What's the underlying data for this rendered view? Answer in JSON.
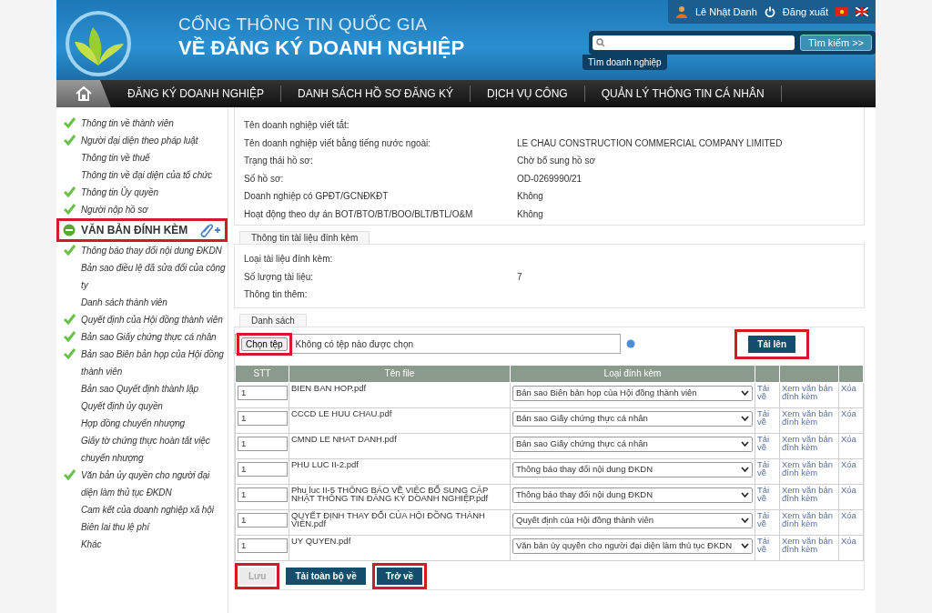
{
  "header": {
    "title_line1": "CỔNG THÔNG TIN QUỐC GIA",
    "title_line2": "VỀ ĐĂNG KÝ DOANH NGHIỆP",
    "user_name": "Lê Nhật Danh",
    "logout": "Đăng xuất",
    "search_button": "Tìm kiếm >>",
    "search_hint": "Tìm doanh nghiệp"
  },
  "nav": {
    "home_selected": true,
    "items": [
      "ĐĂNG KÝ DOANH NGHIỆP",
      "DANH SÁCH HỒ SƠ ĐĂNG KÝ",
      "DỊCH VỤ CÔNG",
      "QUẢN LÝ THÔNG TIN CÁ NHÂN"
    ]
  },
  "sidebar": {
    "items": [
      {
        "kind": "item",
        "label": "Thông tin về thành viên",
        "checked": true
      },
      {
        "kind": "item",
        "label": "Người đại diện theo pháp luật",
        "checked": true
      },
      {
        "kind": "item",
        "label": "Thông tin về thuế",
        "checked": false
      },
      {
        "kind": "item",
        "label": "Thông tin về đại diện của tổ chức",
        "checked": false
      },
      {
        "kind": "item",
        "label": "Thông tin Ủy quyền",
        "checked": true
      },
      {
        "kind": "item",
        "label": "Người nộp hồ sơ",
        "checked": true
      },
      {
        "kind": "section",
        "label": "VĂN BẢN ĐÍNH KÈM",
        "highlighted": true
      },
      {
        "kind": "item",
        "label": "Thông báo thay đổi nội dung ĐKDN",
        "checked": true
      },
      {
        "kind": "item",
        "label": "Bản sao điều lệ đã sửa đổi của công ty",
        "checked": false
      },
      {
        "kind": "item",
        "label": "Danh sách thành viên",
        "checked": false
      },
      {
        "kind": "item",
        "label": "Quyết định của Hội đồng thành viên",
        "checked": true
      },
      {
        "kind": "item",
        "label": "Bản sao Giấy chứng thực cá nhân",
        "checked": true
      },
      {
        "kind": "item",
        "label": "Bản sao Biên bản họp của Hội đồng thành viên",
        "checked": true
      },
      {
        "kind": "item",
        "label": "Bản sao Quyết định thành lập",
        "checked": false
      },
      {
        "kind": "item",
        "label": "Quyết định ủy quyền",
        "checked": false
      },
      {
        "kind": "item",
        "label": "Hợp đồng chuyển nhượng",
        "checked": false
      },
      {
        "kind": "item",
        "label": "Giấy tờ chứng thực hoàn tất việc chuyển nhượng",
        "checked": false
      },
      {
        "kind": "item",
        "label": "Văn bản ủy quyền cho người đại diện làm thủ tục ĐKDN",
        "checked": true
      },
      {
        "kind": "item",
        "label": "Cam kết của doanh nghiệp xã hội",
        "checked": false
      },
      {
        "kind": "item",
        "label": "Biên lai thu lệ phí",
        "checked": false
      },
      {
        "kind": "item",
        "label": "Khác",
        "checked": false
      }
    ]
  },
  "details": [
    {
      "label": "Tên doanh nghiệp viết tắt:"
    },
    {
      "label": "Tên doanh nghiệp viết bằng tiếng nước ngoài:",
      "value": "LE CHAU CONSTRUCTION COMMERCIAL COMPANY LIMITED"
    },
    {
      "label": "Trạng thái hồ sơ:",
      "value": "Chờ bổ sung hồ sơ"
    },
    {
      "label": "Số hồ sơ:",
      "value": "OD-0269990/21"
    },
    {
      "label": "Doanh nghiệp có GPĐT/GCNĐKĐT",
      "value": "Không"
    },
    {
      "label": "Hoạt động theo dự án BOT/BTO/BT/BOO/BLT/BTL/O&M",
      "value": "Không"
    }
  ],
  "attachment_info": {
    "legend": "Thông tin tài liệu đính kèm",
    "rows": [
      {
        "label": "Loại tài liệu đính kèm:"
      },
      {
        "label": "Số lượng tài liệu:",
        "value": "7"
      },
      {
        "label": "Thông tin thêm:"
      }
    ]
  },
  "list": {
    "legend": "Danh sách",
    "choose_file_button": "Chọn tệp",
    "choose_highlighted": true,
    "file_status": "Không có tệp nào được chọn",
    "upload_button": "Tải lên",
    "upload_highlighted": true,
    "columns": [
      "STT",
      "Tên file",
      "Loại đính kèm"
    ],
    "rows": [
      {
        "stt": "1",
        "file_name": "BIEN BAN HOP.pdf",
        "type": "Bản sao Biên bản họp của Hội đồng thành viên",
        "download": "Tải về",
        "view": "Xem văn bản đính kèm",
        "delete": "Xóa"
      },
      {
        "stt": "1",
        "file_name": "CCCD LE HUU CHAU.pdf",
        "type": "Bản sao Giấy chứng thực cá nhân",
        "download": "Tải về",
        "view": "Xem văn bản đính kèm",
        "delete": "Xóa"
      },
      {
        "stt": "1",
        "file_name": "CMND LE NHAT DANH.pdf",
        "type": "Bản sao Giấy chứng thực cá nhân",
        "download": "Tải về",
        "view": "Xem văn bản đính kèm",
        "delete": "Xóa"
      },
      {
        "stt": "1",
        "file_name": "PHU LUC II-2.pdf",
        "type": "Thông báo thay đổi nội dung ĐKDN",
        "download": "Tải về",
        "view": "Xem văn bản đính kèm",
        "delete": "Xóa"
      },
      {
        "stt": "1",
        "file_name": "Phu luc II-5 THÔNG BÁO VỀ VIỆC BỔ SUNG CẬP NHẬT THÔNG TIN ĐĂNG KÝ DOANH NGHIỆP.pdf",
        "type": "Thông báo thay đổi nội dung ĐKDN",
        "download": "Tải về",
        "view": "Xem văn bản đính kèm",
        "delete": "Xóa"
      },
      {
        "stt": "1",
        "file_name": "QUYẾT ĐỊNH THAY ĐỔI CỦA HỘI ĐỒNG THÀNH VIÊN.pdf",
        "type": "Quyết định của Hội đồng thành viên",
        "download": "Tải về",
        "view": "Xem văn bản đính kèm",
        "delete": "Xóa"
      },
      {
        "stt": "1",
        "file_name": "UY QUYEN.pdf",
        "type": "Văn bản ủy quyền cho người đại diện làm thủ tục ĐKDN",
        "download": "Tải về",
        "view": "Xem văn bản đính kèm",
        "delete": "Xóa"
      }
    ]
  },
  "actions": [
    {
      "label": "Lưu",
      "disabled": true,
      "highlighted": true
    },
    {
      "label": "Tải toàn bộ về",
      "disabled": false,
      "highlighted": false
    },
    {
      "label": "Trở về",
      "disabled": false,
      "highlighted": true
    }
  ]
}
